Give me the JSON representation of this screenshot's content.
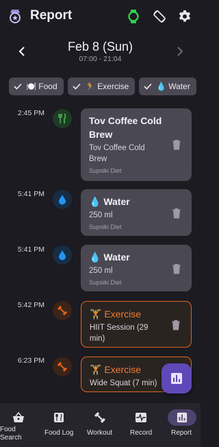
{
  "header": {
    "title": "Report",
    "icons": [
      "award-icon",
      "watch-icon",
      "rotate-screen-icon",
      "gear-icon"
    ],
    "watch_color": "#2fd14a"
  },
  "date_bar": {
    "date": "Feb 8 (Sun)",
    "range": "07:00 - 21:04"
  },
  "filters": [
    {
      "label": "🍽️ Food",
      "checked": true
    },
    {
      "label": "🏃 Exercise",
      "checked": true
    },
    {
      "label": "💧 Water",
      "checked": true
    }
  ],
  "timeline": [
    {
      "time": "2:45 PM",
      "type": "food",
      "icon": "fork-knife-icon",
      "title": "Tov Coffee Cold Brew",
      "desc": "Tov Coffee Cold Brew",
      "source": "Supsiki Diet"
    },
    {
      "time": "5:41 PM",
      "type": "water",
      "icon": "water-drop-icon",
      "title": "💧 Water",
      "desc": "250 ml",
      "source": "Supsiki Diet"
    },
    {
      "time": "5:41 PM",
      "type": "water",
      "icon": "water-drop-icon",
      "title": "💧 Water",
      "desc": "250 ml",
      "source": "Supsiki Diet"
    },
    {
      "time": "5:42 PM",
      "type": "exercise",
      "icon": "dumbbell-icon",
      "title": "🏋️ Exercise",
      "desc": "HIIT Session (29 min)",
      "source": ""
    },
    {
      "time": "6:23 PM",
      "type": "exercise",
      "icon": "dumbbell-icon",
      "title": "🏋️ Exercise",
      "desc": "Wide Squat (7 min)",
      "source": ""
    }
  ],
  "bottom_nav": [
    {
      "label": "Food Search",
      "icon": "basket-icon",
      "active": false
    },
    {
      "label": "Food Log",
      "icon": "food-log-icon",
      "active": false
    },
    {
      "label": "Workout",
      "icon": "dumbbell-icon",
      "active": false
    },
    {
      "label": "Record",
      "icon": "heartbeat-icon",
      "active": false
    },
    {
      "label": "Report",
      "icon": "bar-chart-icon",
      "active": true
    }
  ],
  "colors": {
    "background": "#1c1b21",
    "card": "#4a4852",
    "exercise_accent": "#e2641c",
    "water_accent": "#1e88e5",
    "food_accent": "#43a047",
    "fab": "#5f49b8"
  }
}
